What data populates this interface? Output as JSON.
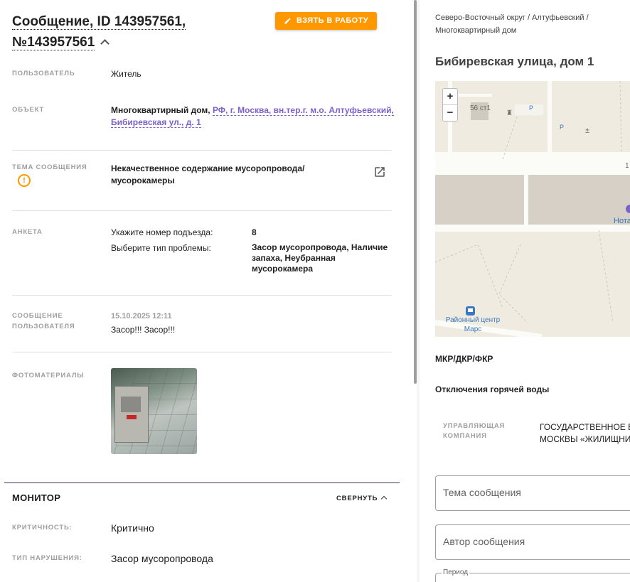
{
  "header": {
    "title_line1": "Сообщение, ID 143957561,",
    "title_line2": "№143957561",
    "take_button": "ВЗЯТЬ В РАБОТУ"
  },
  "details": {
    "user_label": "ПОЛЬЗОВАТЕЛЬ",
    "user_value": "Житель",
    "object_label": "ОБЪЕКТ",
    "object_type": "Многоквартирный дом,",
    "object_link_line1": "РФ, г. Москва, вн.тер.г. м.о. Алтуфьевский,",
    "object_link_line2": "Бибиревская ул., д. 1",
    "topic_label": "ТЕМА СООБЩЕНИЯ",
    "topic_line1": "Некачественное содержание мусоропровода/",
    "topic_line2": "мусорокамеры",
    "survey_label": "АНКЕТА",
    "survey_q1": "Укажите номер подъезда:",
    "survey_a1": "8",
    "survey_q2": "Выберите тип проблемы:",
    "survey_a2_line1": "Засор мусоропровода, Наличие",
    "survey_a2_line2": "запаха, Неубранная",
    "survey_a2_line3": "мусорокамера",
    "message_label_line1": "СООБЩЕНИЕ",
    "message_label_line2": "ПОЛЬЗОВАТЕЛЯ",
    "message_date": "15.10.2025 12:11",
    "message_text": "Засор!!! Засор!!!",
    "photos_label": "ФОТОМАТЕРИАЛЫ"
  },
  "monitor": {
    "title": "МОНИТОР",
    "collapse_label": "СВЕРНУТЬ",
    "criticality_label": "КРИТИЧНОСТЬ:",
    "criticality_value": "Критично",
    "violation_label": "ТИП НАРУШЕНИЯ:",
    "violation_value": "Засор мусоропровода"
  },
  "right": {
    "breadcrumb_line1": "Северо-Восточный округ / Алтуфьевский /",
    "breadcrumb_line2": "Многоквартирный дом",
    "address": "Бибиревская улица, дом 1",
    "map": {
      "zoom_in": "+",
      "zoom_out": "−",
      "label_building": "56 ст1",
      "label_num": "1",
      "label_poi": "Нота",
      "label_center_line1": "Районный центр",
      "label_center_line2": "Марс",
      "parking": "P"
    },
    "mkr": "МКР/ДКР/ФКР",
    "hot_water": "Отключения горячей воды",
    "mc_label_line1": "УПРАВЛЯЮЩАЯ",
    "mc_label_line2": "КОМПАНИЯ",
    "mc_value_line1": "ГОСУДАРСТВЕННОЕ Б",
    "mc_value_line2": "МОСКВЫ «ЖИЛИЩНИ",
    "field_topic": "Тема сообщения",
    "field_author": "Автор сообщения",
    "field_period": "Период"
  },
  "colors": {
    "accent": "#ff9800",
    "link": "#7b61c9",
    "monitor_line": "#3f2e63"
  }
}
